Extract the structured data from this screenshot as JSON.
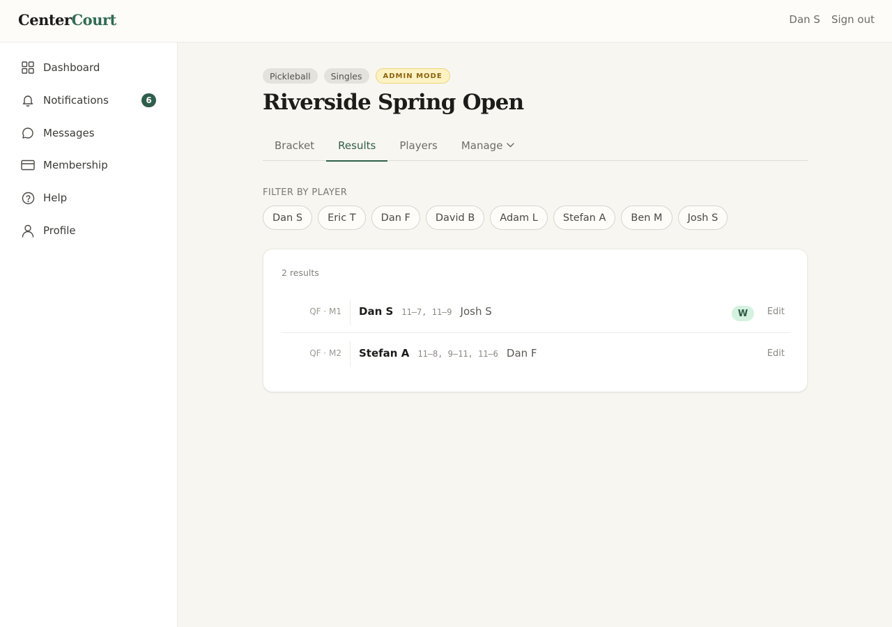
{
  "app": {
    "logo_part1": "Center",
    "logo_part2": "Court",
    "user_name": "Dan S",
    "sign_out_label": "Sign out"
  },
  "sidebar": {
    "items": [
      {
        "label": "Dashboard",
        "icon": "grid-icon"
      },
      {
        "label": "Notifications",
        "icon": "bell-icon",
        "badge": "6"
      },
      {
        "label": "Messages",
        "icon": "chat-icon"
      },
      {
        "label": "Membership",
        "icon": "card-icon"
      },
      {
        "label": "Help",
        "icon": "help-icon"
      },
      {
        "label": "Profile",
        "icon": "user-icon"
      }
    ]
  },
  "tournament": {
    "tags": [
      "Pickleball",
      "Singles"
    ],
    "admin_tag": "ADMIN MODE",
    "title": "Riverside Spring Open"
  },
  "tabs": [
    {
      "label": "Bracket",
      "active": false
    },
    {
      "label": "Results",
      "active": true
    },
    {
      "label": "Players",
      "active": false
    },
    {
      "label": "Manage",
      "active": false,
      "dropdown": true
    }
  ],
  "filter": {
    "label": "Filter by player",
    "players": [
      "Dan S",
      "Eric T",
      "Dan F",
      "David B",
      "Adam L",
      "Stefan A",
      "Ben M",
      "Josh S"
    ]
  },
  "results": {
    "count_label": "2 results",
    "rows": [
      {
        "round": "QF · M1",
        "winner": "Dan S",
        "score": "11–7, 11–9",
        "loser": "Josh S",
        "badge": "W",
        "edit_label": "Edit"
      },
      {
        "round": "QF · M2",
        "winner": "Stefan A",
        "score": "11–8, 9–11, 11–6",
        "loser": "Dan F",
        "edit_label": "Edit"
      }
    ]
  },
  "colors": {
    "accent": "#2f5e4a",
    "background": "#f8f6f0",
    "admin_badge": "#fdf2c4",
    "win_badge": "#d5f1e0"
  }
}
